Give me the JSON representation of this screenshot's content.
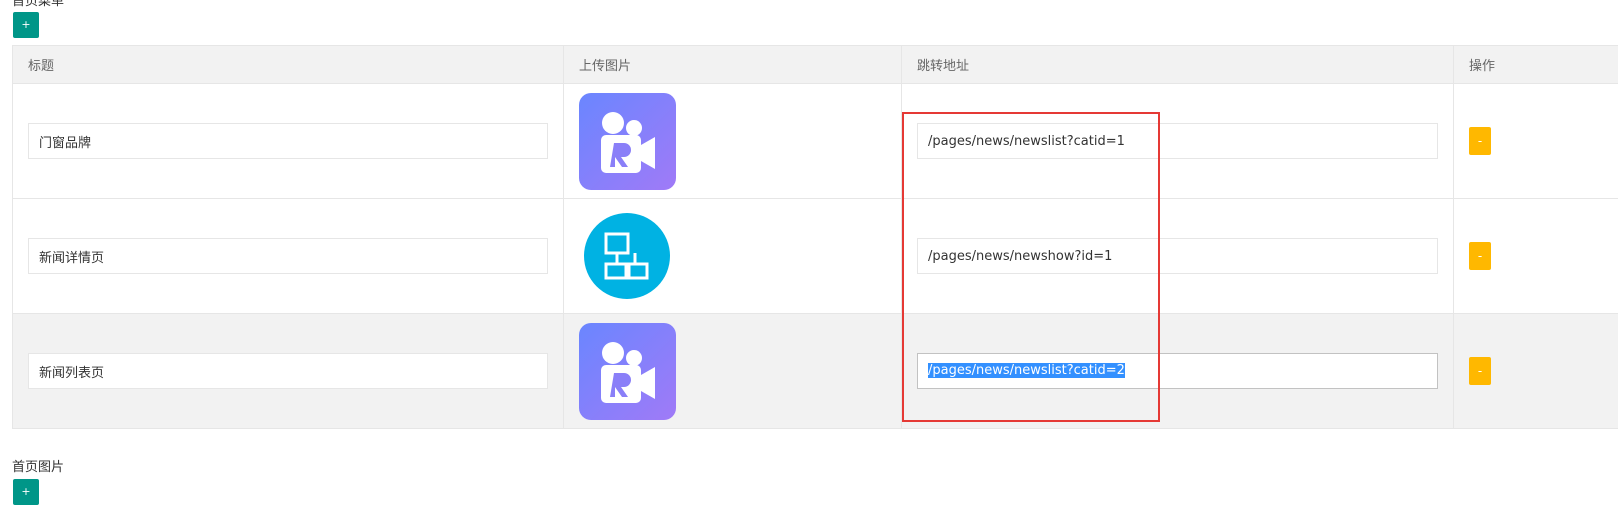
{
  "sections": {
    "first_label": "首页菜单",
    "first_add": "+",
    "second_label": "首页图片",
    "second_add": "+"
  },
  "table": {
    "headers": [
      "标题",
      "上传图片",
      "跳转地址",
      "操作"
    ],
    "rows": [
      {
        "title": "门窗品牌",
        "icon": "video-r-icon",
        "url": "/pages/news/newslist?catid=1",
        "action": "-"
      },
      {
        "title": "新闻详情页",
        "icon": "flowchart-circle-icon",
        "url": "/pages/news/newshow?id=1",
        "action": "-"
      },
      {
        "title": "新闻列表页",
        "icon": "video-r-icon",
        "url": "/pages/news/newslist?catid=2",
        "action": "-"
      }
    ]
  },
  "colors": {
    "add_button": "#009688",
    "remove_button": "#FFB800",
    "highlight_border": "#e53935",
    "selection": "#3390ff"
  }
}
